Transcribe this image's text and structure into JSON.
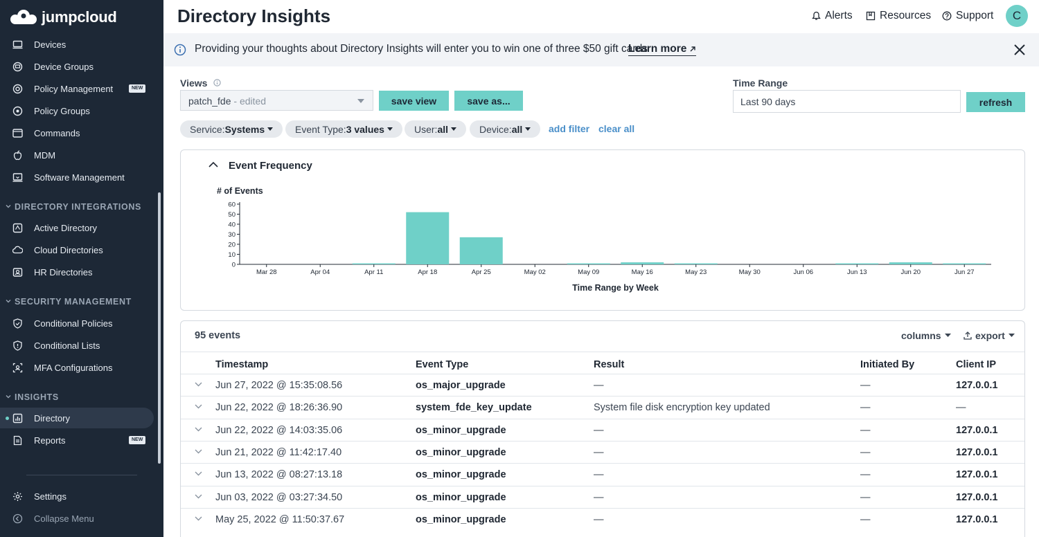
{
  "app": {
    "logo_text": "jumpcloud"
  },
  "sidebar": {
    "items": [
      {
        "label": "Devices",
        "icon": "devices-icon"
      },
      {
        "label": "Device Groups",
        "icon": "device-groups-icon"
      },
      {
        "label": "Policy Management",
        "icon": "policy-management-icon",
        "badge": "NEW"
      },
      {
        "label": "Policy Groups",
        "icon": "policy-groups-icon"
      },
      {
        "label": "Commands",
        "icon": "commands-icon"
      },
      {
        "label": "MDM",
        "icon": "apple-icon"
      },
      {
        "label": "Software Management",
        "icon": "software-management-icon"
      }
    ],
    "sections": [
      {
        "title": "DIRECTORY INTEGRATIONS",
        "items": [
          {
            "label": "Active Directory",
            "icon": "active-directory-icon"
          },
          {
            "label": "Cloud Directories",
            "icon": "cloud-directories-icon"
          },
          {
            "label": "HR Directories",
            "icon": "hr-directories-icon"
          }
        ]
      },
      {
        "title": "SECURITY MANAGEMENT",
        "items": [
          {
            "label": "Conditional Policies",
            "icon": "shield-check-icon"
          },
          {
            "label": "Conditional Lists",
            "icon": "shield-list-icon"
          },
          {
            "label": "MFA Configurations",
            "icon": "mfa-icon"
          }
        ]
      },
      {
        "title": "INSIGHTS",
        "items": [
          {
            "label": "Directory",
            "icon": "bar-chart-icon",
            "active": true
          },
          {
            "label": "Reports",
            "icon": "reports-icon",
            "badge": "NEW"
          }
        ]
      }
    ],
    "footer": [
      {
        "label": "Settings",
        "icon": "gear-icon"
      },
      {
        "label": "Collapse Menu",
        "icon": "collapse-icon"
      }
    ]
  },
  "header": {
    "title": "Directory Insights",
    "links": [
      {
        "label": "Alerts",
        "icon": "bell-icon"
      },
      {
        "label": "Resources",
        "icon": "book-icon"
      },
      {
        "label": "Support",
        "icon": "help-icon"
      }
    ],
    "avatar_initial": "C"
  },
  "banner": {
    "text": "Providing your thoughts about Directory Insights will enter you to win one of three $50 gift cards",
    "link": "Learn more"
  },
  "views": {
    "label": "Views",
    "selected": "patch_fde",
    "selected_suffix": "- edited",
    "save_view": "save view",
    "save_as": "save as..."
  },
  "time_range": {
    "label": "Time Range",
    "value": "Last 90 days",
    "refresh": "refresh"
  },
  "filters": [
    {
      "key": "Service:",
      "value": "Systems"
    },
    {
      "key": "Event Type:",
      "value": "3 values"
    },
    {
      "key": "User:",
      "value": "all"
    },
    {
      "key": "Device:",
      "value": "all"
    }
  ],
  "filter_links": {
    "add": "add filter",
    "clear": "clear all"
  },
  "chart_data": {
    "type": "bar",
    "title": "Event Frequency",
    "ylabel": "# of Events",
    "xlabel": "Time Range by Week",
    "ylim": [
      0,
      60
    ],
    "yticks": [
      0,
      10,
      20,
      30,
      40,
      50,
      60
    ],
    "categories": [
      "Mar 28",
      "Apr 04",
      "Apr 11",
      "Apr 18",
      "Apr 25",
      "May 02",
      "May 09",
      "May 16",
      "May 23",
      "May 30",
      "Jun 06",
      "Jun 13",
      "Jun 20",
      "Jun 27"
    ],
    "values": [
      0,
      0,
      1,
      52,
      27,
      0,
      1,
      2,
      1,
      0,
      0,
      1,
      2,
      1
    ],
    "bar_color": "#6fd0c8",
    "grid": false
  },
  "table": {
    "count": "95 events",
    "columns_label": "columns",
    "export_label": "export",
    "headers": [
      "Timestamp",
      "Event Type",
      "Result",
      "Initiated By",
      "Client IP"
    ],
    "rows": [
      [
        "Jun 27, 2022 @ 15:35:08.56",
        "os_major_upgrade",
        "—",
        "—",
        "127.0.0.1"
      ],
      [
        "Jun 22, 2022 @ 18:26:36.90",
        "system_fde_key_update",
        "System file disk encryption key updated",
        "—",
        "—"
      ],
      [
        "Jun 22, 2022 @ 14:03:35.06",
        "os_minor_upgrade",
        "—",
        "—",
        "127.0.0.1"
      ],
      [
        "Jun 21, 2022 @ 11:42:17.40",
        "os_minor_upgrade",
        "—",
        "—",
        "127.0.0.1"
      ],
      [
        "Jun 13, 2022 @ 08:27:13.18",
        "os_minor_upgrade",
        "—",
        "—",
        "127.0.0.1"
      ],
      [
        "Jun 03, 2022 @ 03:27:34.50",
        "os_minor_upgrade",
        "—",
        "—",
        "127.0.0.1"
      ],
      [
        "May 25, 2022 @ 11:50:37.67",
        "os_minor_upgrade",
        "—",
        "—",
        "127.0.0.1"
      ]
    ]
  }
}
